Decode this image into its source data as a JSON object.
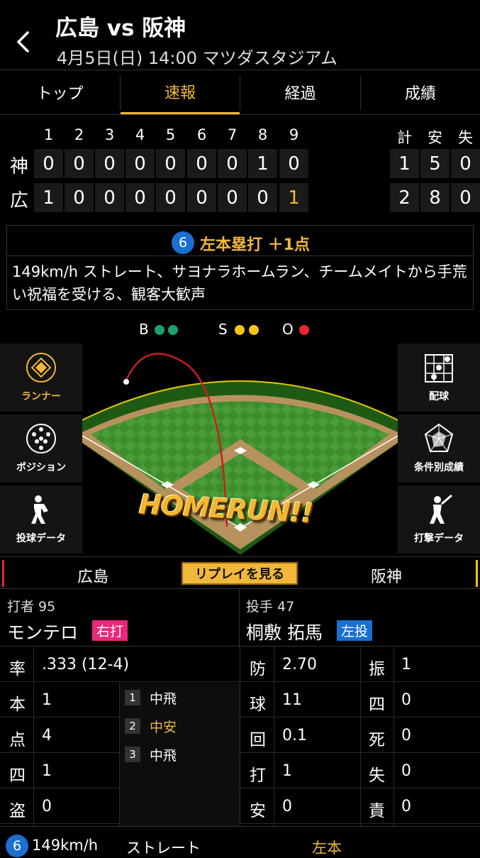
{
  "header": {
    "title": "広島 vs 阪神",
    "subtitle": "4月5日(日) 14:00 マツダスタジアム"
  },
  "tabs": [
    "トップ",
    "速報",
    "経過",
    "成績"
  ],
  "scoreboard": {
    "innings": [
      "1",
      "2",
      "3",
      "4",
      "5",
      "6",
      "7",
      "8",
      "9"
    ],
    "totals_headers": [
      "計",
      "安",
      "失"
    ],
    "teams": [
      {
        "abbr": "神",
        "scores": [
          "0",
          "0",
          "0",
          "0",
          "0",
          "0",
          "0",
          "1",
          "0"
        ],
        "totals": [
          "1",
          "5",
          "0"
        ]
      },
      {
        "abbr": "広",
        "scores": [
          "1",
          "0",
          "0",
          "0",
          "0",
          "0",
          "0",
          "0",
          "1"
        ],
        "totals": [
          "2",
          "8",
          "0"
        ]
      }
    ]
  },
  "play": {
    "badge": "6",
    "title": "左本塁打 ＋1点",
    "description": "149km/h ストレート、サヨナラホームラン、チームメイトから手荒い祝福を受ける、観客大歓声"
  },
  "count": {
    "b_label": "B",
    "s_label": "S",
    "o_label": "O",
    "balls": 2,
    "strikes": 2,
    "outs": 1
  },
  "left_menu": [
    "ランナー",
    "ポジション",
    "投球データ"
  ],
  "right_menu": [
    "配球",
    "条件別成績",
    "打撃データ"
  ],
  "field": {
    "banner": "HOMERUN!!"
  },
  "replay_bar": {
    "left": "広島",
    "button": "リプレイを見る",
    "right": "阪神"
  },
  "batter": {
    "role": "打者 95",
    "name": "モンテロ",
    "tag": "右打",
    "stats": [
      {
        "k": "率",
        "v": ".333 (12-4)"
      },
      {
        "k": "本",
        "v": "1"
      },
      {
        "k": "点",
        "v": "4"
      },
      {
        "k": "四",
        "v": "1"
      },
      {
        "k": "盗",
        "v": "0"
      }
    ],
    "at_bats": [
      {
        "n": "1",
        "r": "中飛"
      },
      {
        "n": "2",
        "r": "中安"
      },
      {
        "n": "3",
        "r": "中飛"
      }
    ]
  },
  "pitcher": {
    "role": "投手 47",
    "name": "桐敷 拓馬",
    "tag": "左投",
    "stats_left": [
      {
        "k": "防",
        "v": "2.70"
      },
      {
        "k": "球",
        "v": "11"
      },
      {
        "k": "回",
        "v": "0.1"
      },
      {
        "k": "打",
        "v": "1"
      },
      {
        "k": "安",
        "v": "0"
      }
    ],
    "stats_right": [
      {
        "k": "振",
        "v": "1"
      },
      {
        "k": "四",
        "v": "0"
      },
      {
        "k": "死",
        "v": "0"
      },
      {
        "k": "失",
        "v": "0"
      },
      {
        "k": "責",
        "v": "0"
      }
    ]
  },
  "footer": {
    "badge": "6",
    "speed": "149km/h",
    "pitch": "ストレート",
    "result": "左本"
  },
  "colors": {
    "accent": "#f0b73a",
    "green": "#1aa06e",
    "yellow": "#f5c518",
    "red": "#e8262c",
    "blue": "#1a6fd1",
    "pink": "#e8287a"
  }
}
